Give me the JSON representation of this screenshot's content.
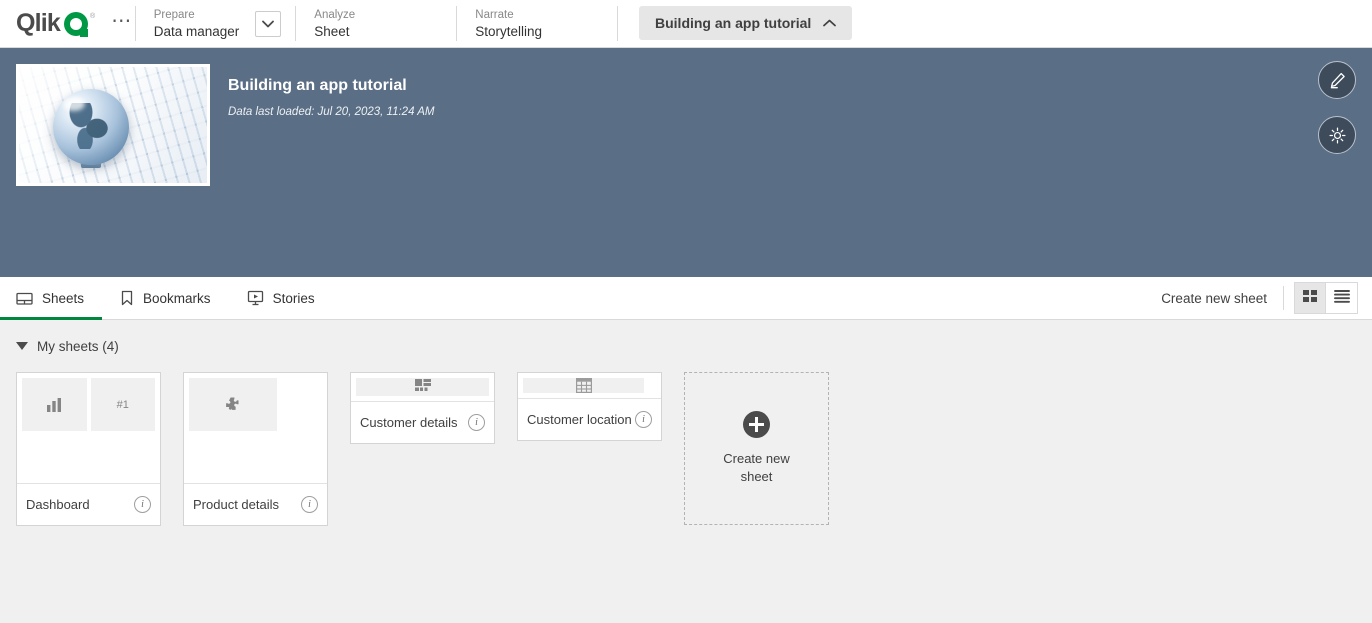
{
  "topbar": {
    "logo_text": "Qlik",
    "logo_reg": "®",
    "more_icon": "ellipsis-icon",
    "menus": [
      {
        "kicker": "Prepare",
        "label": "Data manager",
        "has_dropdown": true
      },
      {
        "kicker": "Analyze",
        "label": "Sheet",
        "has_dropdown": false
      },
      {
        "kicker": "Narrate",
        "label": "Storytelling",
        "has_dropdown": false
      }
    ],
    "app_pill": {
      "label": "Building an app tutorial",
      "chevron": "chevron-up-icon"
    }
  },
  "banner": {
    "background_color": "#5a6e85",
    "thumbnail_alt": "globe-on-keyboard-image",
    "title": "Building an app tutorial",
    "subtitle": "Data last loaded: Jul 20, 2023, 11:24 AM",
    "actions": [
      {
        "name": "edit-app-button",
        "icon": "pencil-icon"
      },
      {
        "name": "app-settings-button",
        "icon": "gear-icon"
      }
    ]
  },
  "tabbar": {
    "tabs": [
      {
        "label": "Sheets",
        "icon": "sheet-icon",
        "active": true
      },
      {
        "label": "Bookmarks",
        "icon": "bookmark-icon",
        "active": false
      },
      {
        "label": "Stories",
        "icon": "story-icon",
        "active": false
      }
    ],
    "create_new_sheet": "Create new sheet",
    "view_modes": [
      {
        "name": "grid-view",
        "icon": "grid-icon",
        "active": true
      },
      {
        "name": "list-view",
        "icon": "list-icon",
        "active": false
      }
    ],
    "active_accent_color": "#00873d"
  },
  "sheets_section": {
    "title": "My sheets (4)",
    "expanded": true,
    "cards": [
      {
        "name": "Dashboard",
        "thumb_type": "two-tile",
        "tile_icons": [
          "bar-chart-icon",
          "#1"
        ],
        "info_icon": "info-icon"
      },
      {
        "name": "Product details",
        "thumb_type": "part-tile",
        "tile_icons": [
          "puzzle-piece-icon"
        ],
        "info_icon": "info-icon"
      },
      {
        "name": "Customer details",
        "thumb_type": "full-tile",
        "tile_icons": [
          "treemap-icon"
        ],
        "info_icon": "info-icon"
      },
      {
        "name": "Customer location",
        "thumb_type": "full-tile",
        "tile_icons": [
          "table-icon"
        ],
        "info_icon": "info-icon"
      }
    ],
    "create_card": {
      "label": "Create new sheet",
      "icon": "plus-circle-icon"
    }
  }
}
